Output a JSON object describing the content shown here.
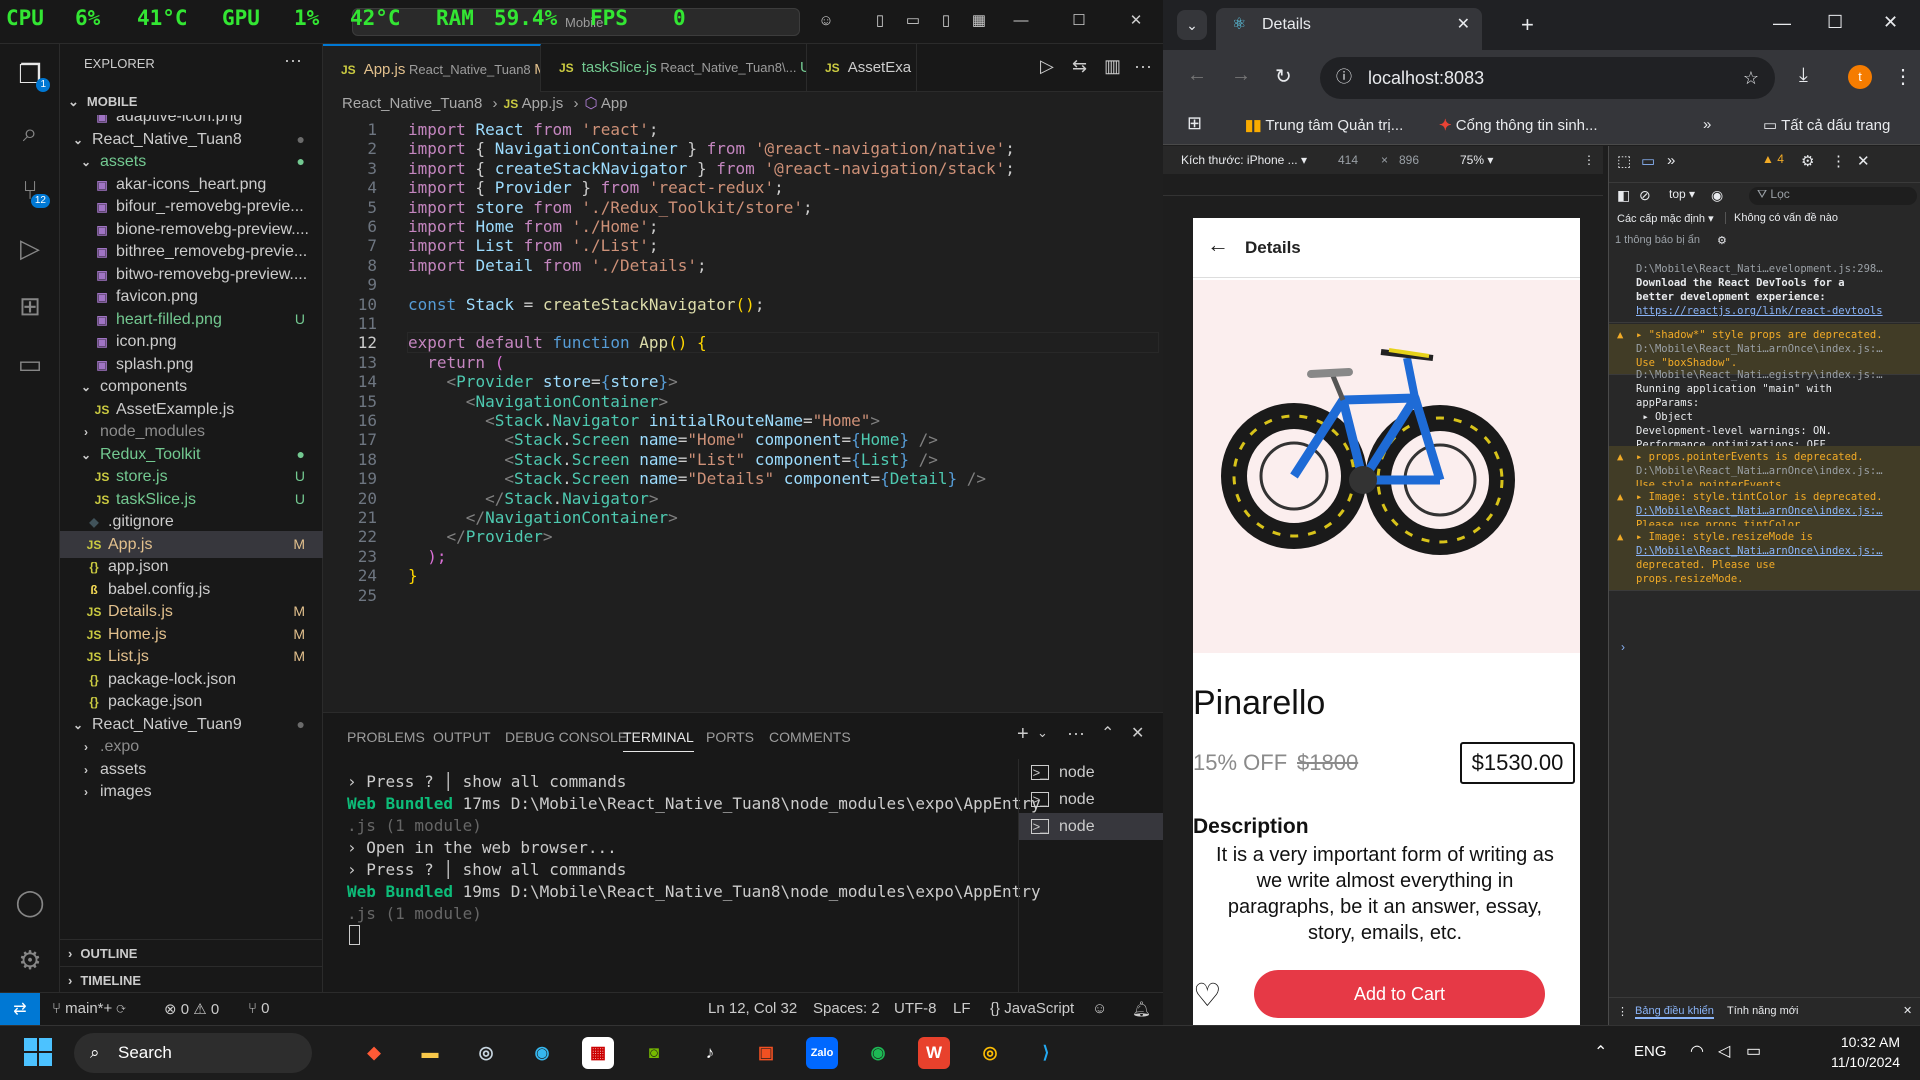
{
  "overlay": {
    "cpu_label": "CPU",
    "cpu_val": "6%",
    "cpu_temp": "41°C",
    "gpu_label": "GPU",
    "gpu_val": "1%",
    "gpu_temp": "42°C",
    "ram_label": "RAM",
    "ram_val": "59.4%",
    "fps_label": "FPS",
    "fps_val": "0"
  },
  "vscode": {
    "search_text": "Mobile",
    "explorer_title": "EXPLORER",
    "root": "MOBILE",
    "tree": [
      {
        "label": "React_Native_Tuan8",
        "kind": "folder-open",
        "indent": 1,
        "status": "●",
        "cls": "dot"
      },
      {
        "label": "assets",
        "kind": "folder-open",
        "indent": 2,
        "status": "●",
        "cls": "unt",
        "color": "unt"
      },
      {
        "label": "akar-icons_heart.png",
        "kind": "img",
        "indent": 3
      },
      {
        "label": "bifour_-removebg-previe...",
        "kind": "img",
        "indent": 3
      },
      {
        "label": "bione-removebg-preview....",
        "kind": "img",
        "indent": 3
      },
      {
        "label": "bithree_removebg-previe...",
        "kind": "img",
        "indent": 3
      },
      {
        "label": "bitwo-removebg-preview....",
        "kind": "img",
        "indent": 3
      },
      {
        "label": "favicon.png",
        "kind": "img",
        "indent": 3
      },
      {
        "label": "heart-filled.png",
        "kind": "img",
        "indent": 3,
        "status": "U",
        "cls": "unt",
        "color": "unt"
      },
      {
        "label": "icon.png",
        "kind": "img",
        "indent": 3
      },
      {
        "label": "splash.png",
        "kind": "img",
        "indent": 3
      },
      {
        "label": "components",
        "kind": "folder-open",
        "indent": 2
      },
      {
        "label": "AssetExample.js",
        "kind": "js",
        "indent": 3
      },
      {
        "label": "node_modules",
        "kind": "folder",
        "indent": 2,
        "color": "dim"
      },
      {
        "label": "Redux_Toolkit",
        "kind": "folder-open",
        "indent": 2,
        "status": "●",
        "cls": "unt",
        "color": "unt"
      },
      {
        "label": "store.js",
        "kind": "js",
        "indent": 3,
        "status": "U",
        "cls": "unt",
        "color": "unt"
      },
      {
        "label": "taskSlice.js",
        "kind": "js",
        "indent": 3,
        "status": "U",
        "cls": "unt",
        "color": "unt"
      },
      {
        "label": ".gitignore",
        "kind": "git",
        "indent": 2
      },
      {
        "label": "App.js",
        "kind": "js",
        "indent": 2,
        "status": "M",
        "cls": "mod",
        "color": "mod",
        "sel": true
      },
      {
        "label": "app.json",
        "kind": "json",
        "indent": 2
      },
      {
        "label": "babel.config.js",
        "kind": "babel",
        "indent": 2
      },
      {
        "label": "Details.js",
        "kind": "js",
        "indent": 2,
        "status": "M",
        "cls": "mod",
        "color": "mod"
      },
      {
        "label": "Home.js",
        "kind": "js",
        "indent": 2,
        "status": "M",
        "cls": "mod",
        "color": "mod"
      },
      {
        "label": "List.js",
        "kind": "js",
        "indent": 2,
        "status": "M",
        "cls": "mod",
        "color": "mod"
      },
      {
        "label": "package-lock.json",
        "kind": "json",
        "indent": 2
      },
      {
        "label": "package.json",
        "kind": "json",
        "indent": 2
      },
      {
        "label": "React_Native_Tuan9",
        "kind": "folder-open",
        "indent": 1,
        "status": "●",
        "cls": "dot"
      },
      {
        "label": ".expo",
        "kind": "folder",
        "indent": 2,
        "color": "dim"
      },
      {
        "label": "assets",
        "kind": "folder",
        "indent": 2
      }
    ],
    "partial_top": "adaptive-icon.png",
    "partial_bottom": "images",
    "outline": "OUTLINE",
    "timeline": "TIMELINE",
    "tabs": [
      {
        "name": "App.js",
        "path": "React_Native_Tuan8",
        "flag": "M",
        "active": true
      },
      {
        "name": "taskSlice.js",
        "path": "React_Native_Tuan8\\...",
        "flag": "U"
      },
      {
        "name": "AssetExa",
        "path": ""
      }
    ],
    "breadcrumb": [
      "React_Native_Tuan8",
      "App.js",
      "App"
    ],
    "current_line": 12,
    "panel_tabs": [
      "PROBLEMS",
      "OUTPUT",
      "DEBUG CONSOLE",
      "TERMINAL",
      "PORTS",
      "COMMENTS"
    ],
    "panel_active": "TERMINAL",
    "terminal": [
      [
        [
          "› Press ",
          "n"
        ],
        [
          "?",
          "n"
        ],
        [
          " │ show all commands",
          "n"
        ]
      ],
      [
        [
          "Web",
          "g"
        ],
        [
          " Bundled ",
          "g"
        ],
        [
          "17ms D:\\Mobile\\React_Native_Tuan8\\node_modules\\expo\\AppEntry",
          "n"
        ]
      ],
      [
        [
          ".js (1 module)",
          "dim"
        ]
      ],
      [
        [
          "› Open in the web browser...",
          "n"
        ]
      ],
      [
        [
          "› Press ",
          "n"
        ],
        [
          "?",
          "n"
        ],
        [
          " │ show all commands",
          "n"
        ]
      ],
      [
        [
          "Web",
          "g"
        ],
        [
          " Bundled ",
          "g"
        ],
        [
          "19ms D:\\Mobile\\React_Native_Tuan8\\node_modules\\expo\\AppEntry",
          "n"
        ]
      ],
      [
        [
          ".js (1 module)",
          "dim"
        ]
      ]
    ],
    "terminals": [
      "node",
      "node",
      "node"
    ],
    "status": {
      "branch": "main*+",
      "errors": "0",
      "warnings": "0",
      "ports": "0",
      "pos": "Ln 12, Col 32",
      "spaces": "Spaces: 2",
      "enc": "UTF-8",
      "eol": "LF",
      "lang": "JavaScript"
    }
  },
  "chrome": {
    "tab_title": "Details",
    "url": "localhost:8083",
    "profile": "t",
    "bookmarks": [
      "Trung tâm Quản trị...",
      "Cổng thông tin sinh...",
      "Tất cả dấu trang"
    ],
    "device": "Kích thước: iPhone ...",
    "width": "414",
    "height": "896",
    "zoom": "75%",
    "app": {
      "header_title": "Details",
      "product_name": "Pinarello",
      "discount": "15% OFF",
      "old_price": "$1800",
      "price": "$1530.00",
      "desc_title": "Description",
      "desc_text": "It is a very important form of writing as we write almost everything in paragraphs, be it an answer, essay, story, emails, etc.",
      "add_to_cart": "Add to Cart"
    },
    "devtools": {
      "warn_count": "4",
      "context": "top",
      "filter": "Lọc",
      "levels": "Các cấp mặc định",
      "issues": "Không có vấn đề nào",
      "hidden": "1 thông báo bị ẩn",
      "bottom_tabs": [
        "Bảng điều khiển",
        "Tính năng mới"
      ]
    }
  },
  "taskbar": {
    "search": "Search",
    "lang": "ENG",
    "time": "10:32 AM",
    "date": "11/10/2024"
  }
}
